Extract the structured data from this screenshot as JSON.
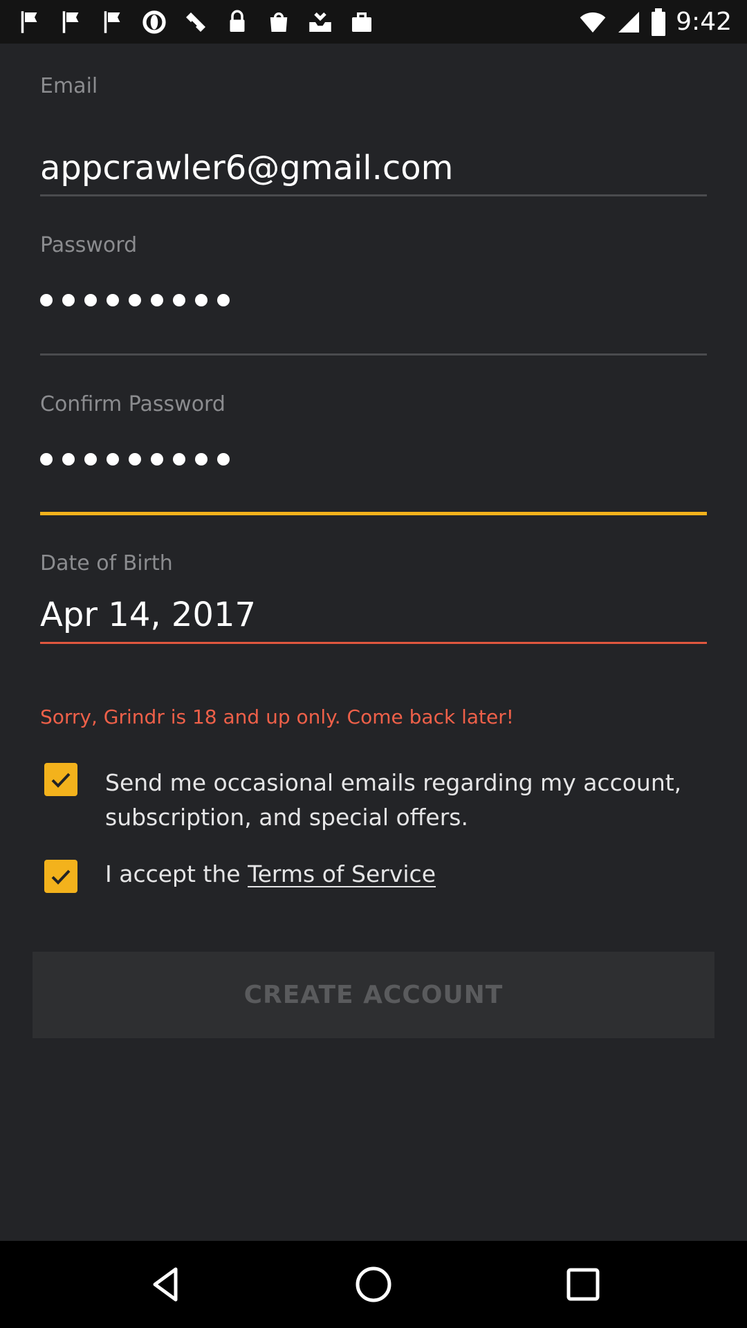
{
  "status_bar": {
    "time": "9:42",
    "icons": [
      "flag-icon",
      "flag-icon",
      "flag-icon",
      "opera-icon",
      "satellite-icon",
      "lock-icon",
      "bag-icon",
      "inbox-icon",
      "bag-icon",
      "wifi-icon",
      "signal-icon",
      "battery-icon"
    ]
  },
  "form": {
    "email": {
      "label": "Email",
      "value": "appcrawler6@gmail.com"
    },
    "password": {
      "label": "Password",
      "masked_length": 9
    },
    "confirm_password": {
      "label": "Confirm Password",
      "masked_length": 9
    },
    "dob": {
      "label": "Date of Birth",
      "value": "Apr 14, 2017",
      "error": "Sorry, Grindr is 18 and up only. Come back later!"
    },
    "emails_opt_in": {
      "checked": true,
      "line1": "Send me occasional emails regarding my account,",
      "line2": "subscription, and special offers."
    },
    "terms": {
      "checked": true,
      "prefix": "I accept the ",
      "link": "Terms of Service"
    },
    "create_button": "CREATE ACCOUNT"
  },
  "colors": {
    "accent": "#f3b21c",
    "error": "#ee6049",
    "background": "#232427"
  }
}
